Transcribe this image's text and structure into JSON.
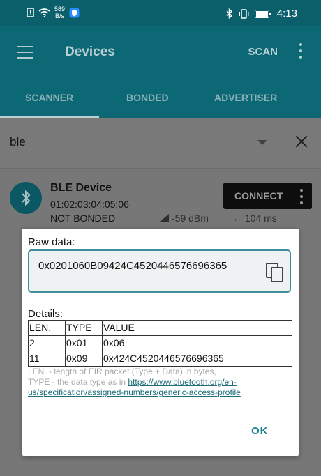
{
  "status_bar": {
    "speed_value": "589",
    "speed_unit": "B/s",
    "time": "4:13",
    "icons": [
      "alert-icon",
      "wifi-icon",
      "shield-icon",
      "bluetooth-icon",
      "vibrate-icon",
      "battery-icon"
    ]
  },
  "app_bar": {
    "title": "Devices",
    "scan_label": "SCAN"
  },
  "tabs": [
    {
      "label": "SCANNER",
      "active": true
    },
    {
      "label": "BONDED",
      "active": false
    },
    {
      "label": "ADVERTISER",
      "active": false
    }
  ],
  "filter": {
    "value": "ble"
  },
  "device": {
    "name": "BLE Device",
    "address": "01:02:03:04:05:06",
    "bond_state": "NOT BONDED",
    "rssi": "-59 dBm",
    "interval": "104 ms",
    "connect_label": "CONNECT"
  },
  "dialog": {
    "raw_label": "Raw data:",
    "raw_value": "0x0201060B09424C4520446576696365",
    "details_label": "Details:",
    "table": {
      "headers": [
        "LEN.",
        "TYPE",
        "VALUE"
      ],
      "rows": [
        [
          "2",
          "0x01",
          "0x06"
        ],
        [
          "11",
          "0x09",
          "0x424C4520446576696365"
        ]
      ]
    },
    "note_line1": "LEN. - length of EIR packet (Type + Data) in bytes,",
    "note_line2_prefix": "TYPE - the data type as in ",
    "note_link": "https://www.bluetooth.org/en-us/specification/assigned-numbers/generic-access-profile",
    "ok_label": "OK"
  },
  "colors": {
    "status_bar": "#0b5f6a",
    "app_bar": "#0d6876",
    "accent": "#1b7f8d",
    "raw_box_border": "#3f8f9b"
  }
}
